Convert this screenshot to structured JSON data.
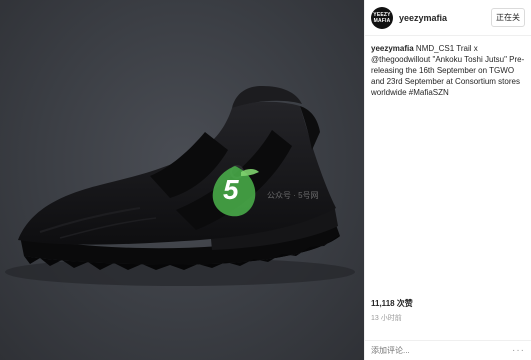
{
  "post": {
    "username": "yeezymafia",
    "avatar_text": [
      "YEEZY",
      "MAFIA"
    ],
    "follow_label": "正在关",
    "caption": {
      "user": "yeezymafia",
      "text": " NMD_CS1 Trail x @thegoodwillout \"Ankoku Toshi Jutsu\" Pre-releasing the 16th September on TGWO and 23rd September at Consortium stores worldwide #MafiaSZN"
    },
    "likes": "11,118 次赞",
    "time": "13 小时前",
    "comment_placeholder": "添加评论...",
    "more_label": "···"
  },
  "watermark": {
    "logo_text": "5",
    "site_text": "公众号 · 5号网"
  },
  "colors": {
    "photo_bg": "#3b3e44",
    "shoe": "#141416",
    "watermark_green": "#4bb34b"
  },
  "icons": [
    "shoe-image",
    "watermark-logo",
    "more-options-icon"
  ]
}
